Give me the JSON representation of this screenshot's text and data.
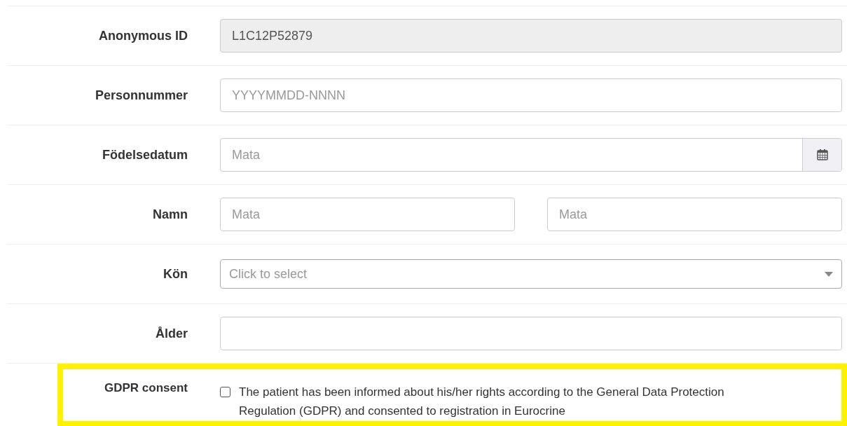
{
  "fields": [
    {
      "label": "Anonymous ID",
      "kind": "text",
      "value": "L1C12P52879",
      "disabled": true
    },
    {
      "label": "Personnummer",
      "kind": "text",
      "placeholder": "YYYYMMDD-NNNN",
      "disabled": false
    },
    {
      "label": "Födelsedatum",
      "kind": "date",
      "placeholder": "Mata",
      "disabled": false
    },
    {
      "label": "Namn",
      "kind": "name",
      "placeholders": [
        "Mata",
        "Mata"
      ],
      "disabled": false
    },
    {
      "label": "Kön",
      "kind": "select",
      "placeholder": "Click to select",
      "disabled": false
    },
    {
      "label": "Ålder",
      "kind": "text",
      "disabled": false
    }
  ],
  "consent": {
    "label": "GDPR consent",
    "text": "The patient has been informed about his/her rights according to the General Data Protection Regulation (GDPR) and consented to registration in Eurocrine",
    "checked": false
  }
}
